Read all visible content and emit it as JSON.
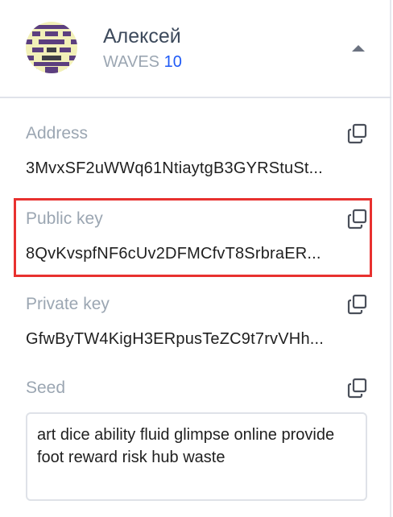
{
  "account": {
    "name": "Алексей",
    "balance_asset": "WAVES",
    "balance_amount": "10"
  },
  "fields": {
    "address": {
      "label": "Address",
      "value": "3MvxSF2uWWq61NtiaytgB3GYRStuSt..."
    },
    "public_key": {
      "label": "Public key",
      "value": "8QvKvspfNF6cUv2DFMCfvT8SrbraER..."
    },
    "private_key": {
      "label": "Private key",
      "value": "GfwByTW4KigH3ERpusTeZC9t7rvVHh..."
    },
    "seed": {
      "label": "Seed",
      "value": "art dice ability fluid glimpse online provide foot reward risk hub waste"
    }
  },
  "icons": {
    "copy": "copy-icon",
    "collapse": "chevron-up-icon",
    "avatar": "identicon-avatar"
  },
  "colors": {
    "label": "#9ba6b2",
    "name": "#3d4a5c",
    "amount": "#1f5af6",
    "highlight": "#e8312f",
    "icon": "#4a4f5a"
  }
}
